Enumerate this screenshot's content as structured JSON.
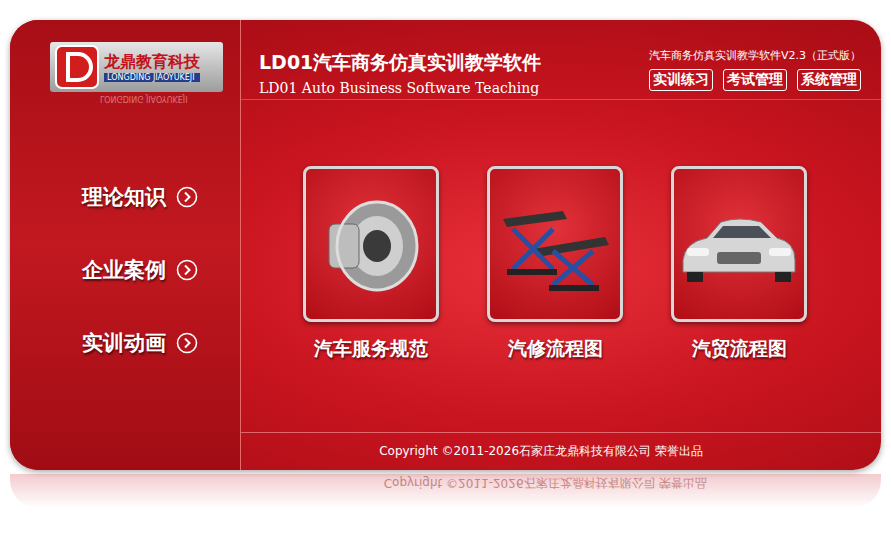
{
  "brand": {
    "name": "龙鼎教育科技",
    "pinyin": "LONGDING JIAOYUKEJI"
  },
  "header": {
    "title": "LD01汽车商务仿真实训教学软件",
    "subtitle": "LD01 Auto Business Software Teaching",
    "version": "汽车商务仿真实训教学软件V2.3（正式版）"
  },
  "top_menu": [
    "实训练习",
    "考试管理",
    "系统管理"
  ],
  "sidebar": {
    "items": [
      "理论知识",
      "企业案例",
      "实训动画"
    ]
  },
  "cards": [
    {
      "label": "汽车服务规范",
      "kind": "seal"
    },
    {
      "label": "汽修流程图",
      "kind": "lift"
    },
    {
      "label": "汽贸流程图",
      "kind": "car"
    }
  ],
  "footer": "Copyright ©2011-2026石家庄龙鼎科技有限公司 荣誉出品"
}
